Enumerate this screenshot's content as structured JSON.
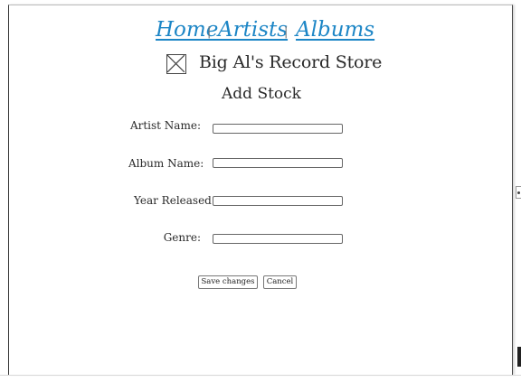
{
  "nav": {
    "links": [
      {
        "label": "Home"
      },
      {
        "label": "Artists"
      },
      {
        "label": "Albums"
      }
    ],
    "separator": "|"
  },
  "brand": {
    "store_name": "Big Al's Record Store",
    "logo_icon": "image-placeholder-icon"
  },
  "page": {
    "title": "Add Stock"
  },
  "form": {
    "fields": [
      {
        "label": "Artist Name:",
        "value": ""
      },
      {
        "label": "Album Name:",
        "value": ""
      },
      {
        "label": "Year Released:",
        "value": ""
      },
      {
        "label": "Genre:",
        "value": ""
      }
    ],
    "save_label": "Save changes",
    "cancel_label": "Cancel"
  },
  "colors": {
    "link": "#1d86c6",
    "text": "#2a2a2a",
    "border": "#666666"
  }
}
